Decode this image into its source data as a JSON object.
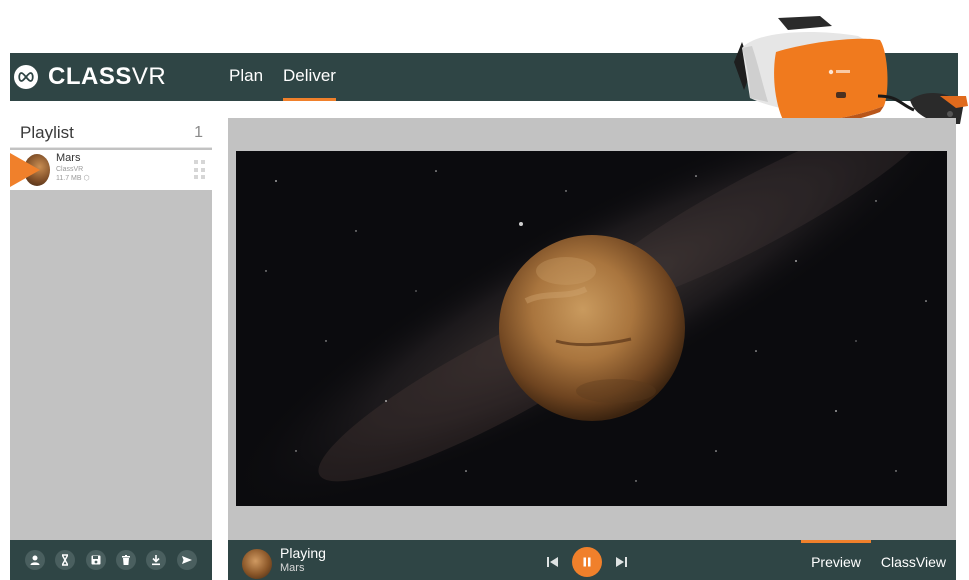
{
  "app": {
    "logo_bold": "CLASS",
    "logo_light": "VR"
  },
  "nav": {
    "tabs": [
      {
        "label": "Plan",
        "active": false
      },
      {
        "label": "Deliver",
        "active": true
      }
    ]
  },
  "playlist": {
    "title": "Playlist",
    "count": "1",
    "items": [
      {
        "name": "Mars",
        "source": "ClassVR",
        "size": "11.7 MB"
      }
    ]
  },
  "toolbar": {
    "icons": [
      "user-icon",
      "hourglass-icon",
      "save-icon",
      "trash-icon",
      "download-icon",
      "send-icon"
    ]
  },
  "player": {
    "status": "Playing",
    "title": "Mars",
    "controls": [
      "skip-previous-icon",
      "pause-icon",
      "skip-next-icon"
    ]
  },
  "view_tabs": [
    {
      "label": "Preview",
      "active": true
    },
    {
      "label": "ClassView",
      "active": false
    }
  ],
  "colors": {
    "header_bg": "#2f4545",
    "accent": "#f0802b",
    "panel_bg": "#c2c2c2"
  }
}
